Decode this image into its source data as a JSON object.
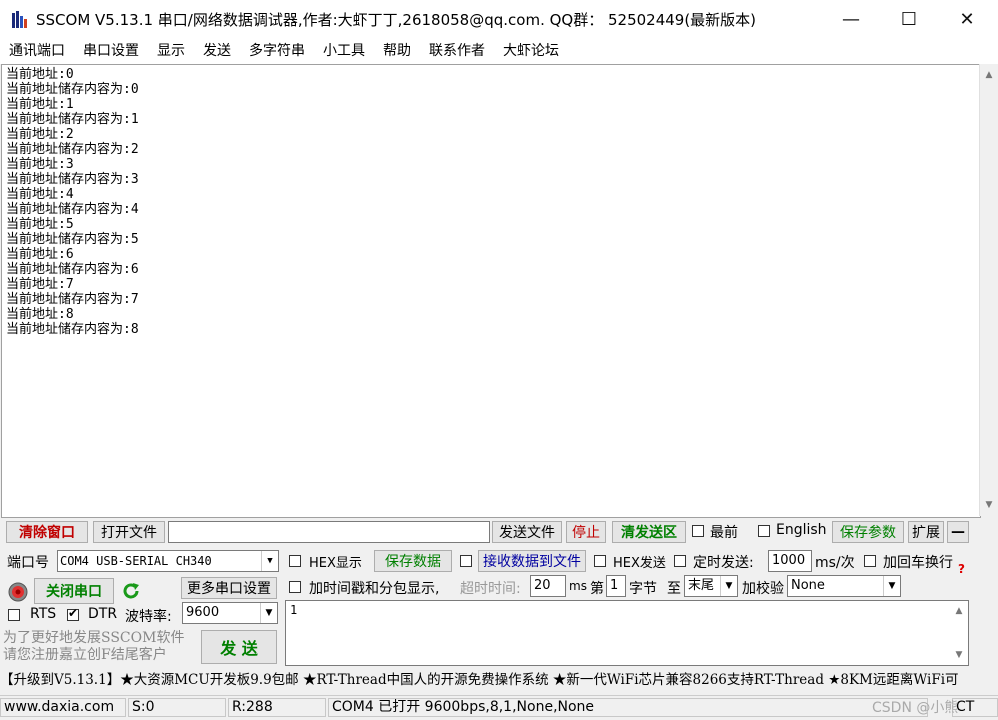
{
  "window": {
    "title": "SSCOM V5.13.1 串口/网络数据调试器,作者:大虾丁丁,2618058@qq.com. QQ群： 52502449(最新版本)",
    "minimize_symbol": "—",
    "maximize_symbol": "☐",
    "close_symbol": "✕"
  },
  "menu": [
    "通讯端口",
    "串口设置",
    "显示",
    "发送",
    "多字符串",
    "小工具",
    "帮助",
    "联系作者",
    "大虾论坛"
  ],
  "receive_lines": [
    "当前地址:0",
    "当前地址储存内容为:0",
    "当前地址:1",
    "当前地址储存内容为:1",
    "当前地址:2",
    "当前地址储存内容为:2",
    "当前地址:3",
    "当前地址储存内容为:3",
    "当前地址:4",
    "当前地址储存内容为:4",
    "当前地址:5",
    "当前地址储存内容为:5",
    "当前地址:6",
    "当前地址储存内容为:6",
    "当前地址:7",
    "当前地址储存内容为:7",
    "当前地址:8",
    "当前地址储存内容为:8"
  ],
  "toolbar": {
    "clear_window": "清除窗口",
    "open_file": "打开文件",
    "file_path": "",
    "send_file": "发送文件",
    "stop": "停止",
    "clear_send_area": "清发送区",
    "topmost": "最前",
    "english": "English",
    "save_params": "保存参数",
    "expand": "扩展",
    "collapse": "—"
  },
  "port": {
    "port_label": "端口号",
    "port_value": "COM4 USB-SERIAL CH340",
    "close_port": "关闭串口",
    "more_settings": "更多串口设置",
    "rts": "RTS",
    "dtr": "DTR",
    "baud_label": "波特率:",
    "baud_value": "9600",
    "promo_line1": "为了更好地发展SSCOM软件",
    "promo_line2": "请您注册嘉立创F结尾客户",
    "send_button": "发  送"
  },
  "options": {
    "hex_display": "HEX显示",
    "save_data": "保存数据",
    "recv_to_file": "接收数据到文件",
    "hex_send": "HEX发送",
    "timed_send": "定时发送:",
    "interval": "1000",
    "interval_unit": "ms/次",
    "add_crlf": "加回车换行",
    "add_timestamp": "加时间戳和分包显示,",
    "timeout_label": "超时时间:",
    "timeout_value": "20",
    "ms": "ms",
    "byte_prefix": "第",
    "byte_value": "1",
    "byte_label": "字节",
    "to": "至",
    "end_value": "末尾",
    "checksum_label": "加校验",
    "checksum_value": "None",
    "help_mark": "?"
  },
  "send_text": "1",
  "ticker": "【升级到V5.13.1】★大资源MCU开发板9.9包邮 ★RT-Thread中国人的开源免费操作系统 ★新一代WiFi芯片兼容8266支持RT-Thread ★8KM远距离WiFi可",
  "status": {
    "site": "www.daxia.com",
    "sent": "S:0",
    "received": "R:288",
    "port_state": "COM4 已打开  9600bps,8,1,None,None",
    "cts": "CT",
    "watermark": "CSDN @小熊"
  }
}
